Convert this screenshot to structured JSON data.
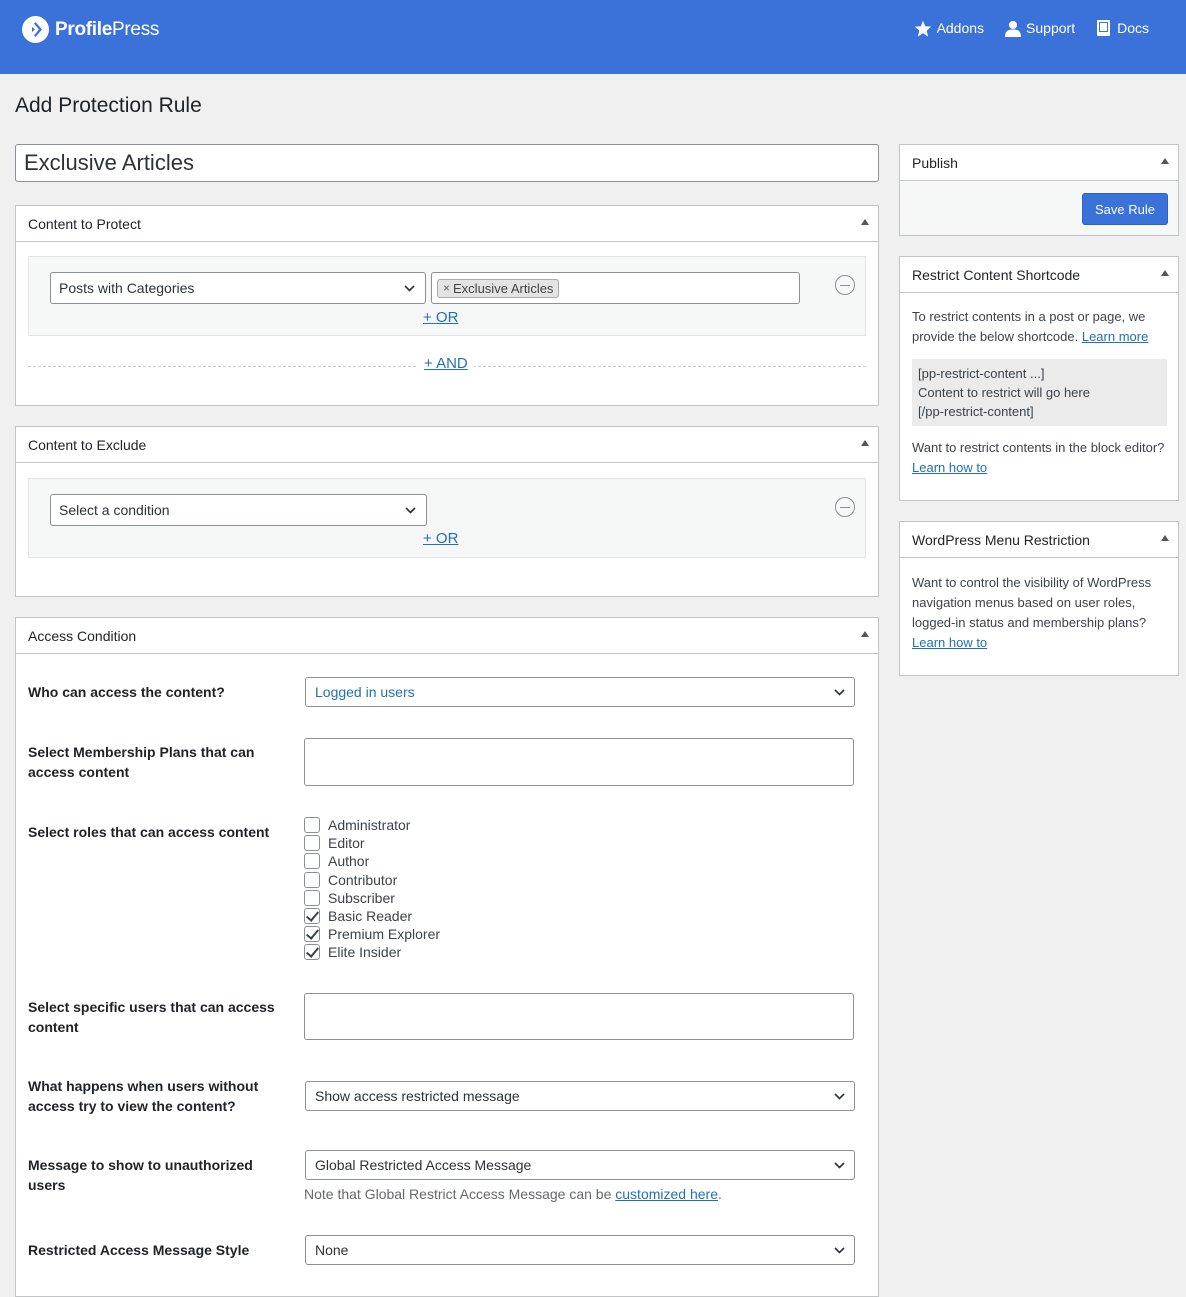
{
  "header": {
    "brand_bold": "Profile",
    "brand_light": "Press",
    "nav": [
      {
        "label": "Addons",
        "icon": "star-icon"
      },
      {
        "label": "Support",
        "icon": "user-icon"
      },
      {
        "label": "Docs",
        "icon": "book-icon"
      }
    ]
  },
  "page": {
    "title": "Add Protection Rule",
    "rule_title": "Exclusive Articles"
  },
  "content_to_protect": {
    "heading": "Content to Protect",
    "condition": "Posts with Categories",
    "tag": "Exclusive Articles",
    "or_label": "+ OR",
    "and_label": "+ AND"
  },
  "content_to_exclude": {
    "heading": "Content to Exclude",
    "condition": "Select a condition",
    "or_label": "+ OR"
  },
  "access_condition": {
    "heading": "Access Condition",
    "who_label": "Who can access the content?",
    "who_value": "Logged in users",
    "plans_label": "Select Membership Plans that can access content",
    "roles_label": "Select roles that can access content",
    "roles": [
      {
        "label": "Administrator",
        "checked": false
      },
      {
        "label": "Editor",
        "checked": false
      },
      {
        "label": "Author",
        "checked": false
      },
      {
        "label": "Contributor",
        "checked": false
      },
      {
        "label": "Subscriber",
        "checked": false
      },
      {
        "label": "Basic Reader",
        "checked": true
      },
      {
        "label": "Premium Explorer",
        "checked": true
      },
      {
        "label": "Elite Insider",
        "checked": true
      }
    ],
    "users_label": "Select specific users that can access content",
    "noaccess_label": "What happens when users without access try to view the content?",
    "noaccess_value": "Show access restricted message",
    "message_label": "Message to show to unauthorized users",
    "message_value": "Global Restricted Access Message",
    "note_text": "Note that Global Restrict Access Message can be ",
    "note_link": "customized here",
    "note_end": ".",
    "style_label": "Restricted Access Message Style",
    "style_value": "None"
  },
  "sidebar": {
    "publish": {
      "heading": "Publish",
      "save_label": "Save Rule"
    },
    "shortcode": {
      "heading": "Restrict Content Shortcode",
      "intro": "To restrict contents in a post or page, we provide the below shortcode.",
      "learn_more": "Learn more",
      "code_lines": [
        "[pp-restrict-content ...]",
        "Content to restrict will go here",
        "[/pp-restrict-content]"
      ],
      "block_text": "Want to restrict contents in the block editor?",
      "learn_how": "Learn how to"
    },
    "menu": {
      "heading": "WordPress Menu Restriction",
      "text": "Want to control the visibility of WordPress navigation menus based on user roles, logged-in status and membership plans?",
      "learn_how": "Learn how to"
    }
  },
  "colors": {
    "brand": "#3b72da",
    "link": "#2271b1",
    "background": "#f0f0f1"
  }
}
